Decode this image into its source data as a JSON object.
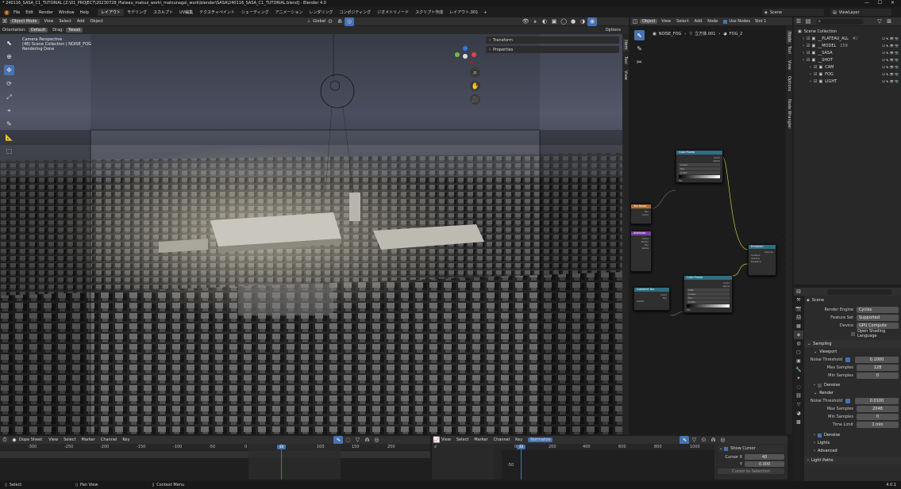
{
  "window": {
    "title": "* 240116_SASA_C1_TUTORIAL [Z:\\01_PROJECT\\20230728_Plateau_matsui_work\\_matsunaga\\_work\\blender\\SASA\\240116_SASA_C1_TUTORIAL.blend] - Blender 4.0"
  },
  "menubar": {
    "items": [
      "File",
      "Edit",
      "Render",
      "Window",
      "Help"
    ],
    "workspaces": [
      "レイアウト",
      "モデリング",
      "スカルプト",
      "UV編集",
      "テクスチャペイント",
      "シェーディング",
      "アニメーション",
      "レンダリング",
      "コンポジティング",
      "ジオメトリノード",
      "スクリプト作成",
      "レイアウト.001"
    ],
    "active_workspace": 0,
    "scene": "Scene",
    "view_layer": "ViewLayer"
  },
  "viewport": {
    "mode": "Object Mode",
    "menus": [
      "View",
      "Select",
      "Add",
      "Object"
    ],
    "orientation_label": "Orientation:",
    "orientation": "Default",
    "drag_label": "Drag:",
    "drag": "Tweak",
    "transform": "Global",
    "options": "Options",
    "info": [
      "Camera Perspective",
      "(48) Scene Collection | NOISE_FOG",
      "Rendering Done"
    ],
    "n_panel": [
      "Transform",
      "Properties"
    ],
    "side_tabs": [
      "Item",
      "Tool",
      "View"
    ]
  },
  "node_editor": {
    "type": "Object",
    "menus": [
      "View",
      "Select",
      "Add",
      "Node"
    ],
    "use_nodes_label": "Use Nodes",
    "slot": "Slot 1",
    "breadcrumb": [
      "NOISE_FOG",
      "立方体.001",
      "FOG_2"
    ],
    "side_tabs": [
      "Node",
      "Tool",
      "View",
      "Options",
      "Node Wrangler"
    ],
    "nodes": [
      {
        "title": "Color Ramp",
        "color": "#2e6e82",
        "out": [
          "Color",
          "Alpha"
        ],
        "vals": [
          "Linear",
          "Pos",
          "0.000"
        ],
        "in": [
          "Fac"
        ]
      },
      {
        "title": "Tex Noise",
        "color": "#b46d2a",
        "out": [
          "Fac",
          "Color"
        ]
      },
      {
        "title": "Attribute",
        "color": "#7a3ea0",
        "out": [
          "Color",
          "Vector",
          "Fac",
          "Alpha"
        ]
      },
      {
        "title": "Color Ramp",
        "color": "#2e6e82",
        "out": [
          "Color",
          "Alpha"
        ],
        "vals": [
          "RGB",
          "Linear",
          "Pos",
          "0.000"
        ],
        "in": [
          "Fac"
        ]
      },
      {
        "title": "Gradient Tex",
        "color": "#2e6e82",
        "out": [
          "Color",
          "Fac"
        ],
        "in": [
          "Vector"
        ]
      },
      {
        "title": "Emission",
        "color": "#2e6e82",
        "out": [
          "Volume"
        ],
        "in": [
          "Surface",
          "Volume",
          "Displace"
        ]
      }
    ]
  },
  "outliner": {
    "root": "Scene Collection",
    "rows": [
      {
        "name": "__PLATEAU_ALL",
        "depth": 1,
        "badge": "4▽"
      },
      {
        "name": "__MODEL",
        "depth": 1,
        "badge": "159"
      },
      {
        "name": "__SASA",
        "depth": 1,
        "badge": ""
      },
      {
        "name": "__SHOT",
        "depth": 1,
        "badge": ""
      },
      {
        "name": "CAM",
        "depth": 2,
        "badge": ""
      },
      {
        "name": "FOG",
        "depth": 2,
        "badge": ""
      },
      {
        "name": "LIGHT",
        "depth": 2,
        "badge": ""
      }
    ]
  },
  "properties": {
    "title": "Scene",
    "render_engine_label": "Render Engine",
    "render_engine": "Cycles",
    "feature_set_label": "Feature Set",
    "feature_set": "Supported",
    "device_label": "Device",
    "device": "GPU Compute",
    "osl_label": "Open Shading Language",
    "sampling": "Sampling",
    "viewport": "Viewport",
    "noise_threshold_label": "Noise Threshold",
    "vp_noise_threshold": "0.1000",
    "max_samples_label": "Max Samples",
    "vp_max_samples": "128",
    "min_samples_label": "Min Samples",
    "vp_min_samples": "0",
    "denoise": "Denoise",
    "render": "Render",
    "r_noise_threshold": "0.0100",
    "r_max_samples": "2048",
    "r_min_samples": "0",
    "time_limit_label": "Time Limit",
    "r_time_limit": "1 min",
    "denoise2": "Denoise",
    "lights": "Lights",
    "advanced": "Advanced",
    "light_paths": "Light Paths"
  },
  "dopesheet": {
    "mode": "Dope Sheet",
    "menus": [
      "View",
      "Select",
      "Marker",
      "Channel",
      "Key"
    ],
    "ticks": [
      "-300",
      "-250",
      "-200",
      "-150",
      "-100",
      "-50",
      "0",
      "50",
      "100",
      "150",
      "200"
    ],
    "current_frame": "48"
  },
  "graph": {
    "menus": [
      "View",
      "Select",
      "Marker",
      "Channel",
      "Key"
    ],
    "normalize": "Normalize",
    "ticks": [
      "0",
      "200",
      "400",
      "600",
      "800",
      "1000"
    ],
    "current_frame": "48",
    "ylabel": "-50"
  },
  "cursor_panel": {
    "show_cursor": "Show Cursor",
    "cursor_x_label": "Cursor X",
    "cursor_x": "48",
    "y_label": "Y",
    "y_value": "0.000",
    "button": "Cursor to Selection"
  },
  "statusbar": {
    "items": [
      "Select",
      "Pan View",
      "Context Menu"
    ],
    "version": "4.0.1"
  },
  "colors": {
    "accent": "#4772b3",
    "bg": "#1d1d1d",
    "header": "#303030",
    "playhead": "#4772b3"
  }
}
